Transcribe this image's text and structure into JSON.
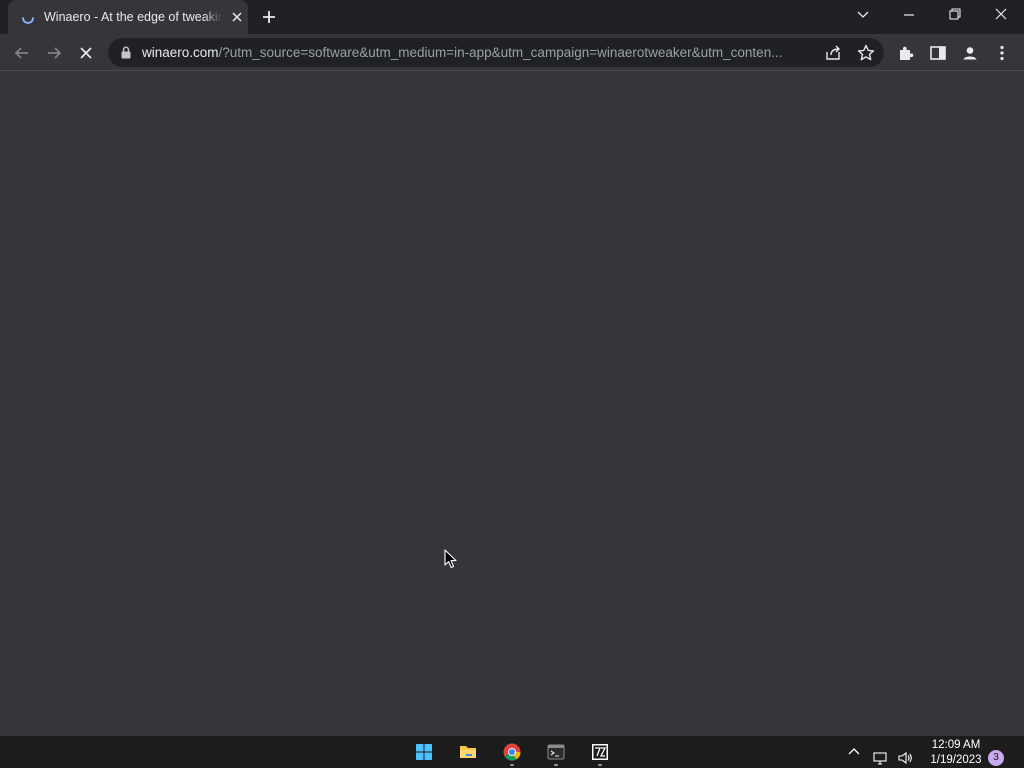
{
  "browser": {
    "tab": {
      "title": "Winaero - At the edge of tweaking",
      "favicon": "loading-spinner-icon",
      "close_icon": "close-icon"
    },
    "new_tab_icon": "plus-icon",
    "window_controls": [
      "tab-search-icon",
      "minimize-icon",
      "restore-icon",
      "close-icon"
    ],
    "nav": [
      "back-icon",
      "forward-icon",
      "stop-icon"
    ],
    "address": {
      "host": "winaero.com",
      "path": "/?utm_source=software&utm_medium=in-app&utm_campaign=winaerotweaker&utm_conten..."
    },
    "toolbar_icons": [
      "share-icon",
      "bookmark-star-icon",
      "extensions-icon",
      "side-panel-icon",
      "profile-icon",
      "menu-icon"
    ],
    "colors": {
      "frame": "#202124",
      "toolbar": "#35363a",
      "text": "#e8eaed",
      "muted": "#9aa0a6"
    }
  },
  "taskbar": {
    "apps": [
      "windows-start-icon",
      "file-explorer-icon",
      "chrome-icon",
      "terminal-icon",
      "7zip-icon"
    ],
    "clock": {
      "time": "12:09 AM",
      "date": "1/19/2023"
    },
    "notification_count": "3"
  }
}
